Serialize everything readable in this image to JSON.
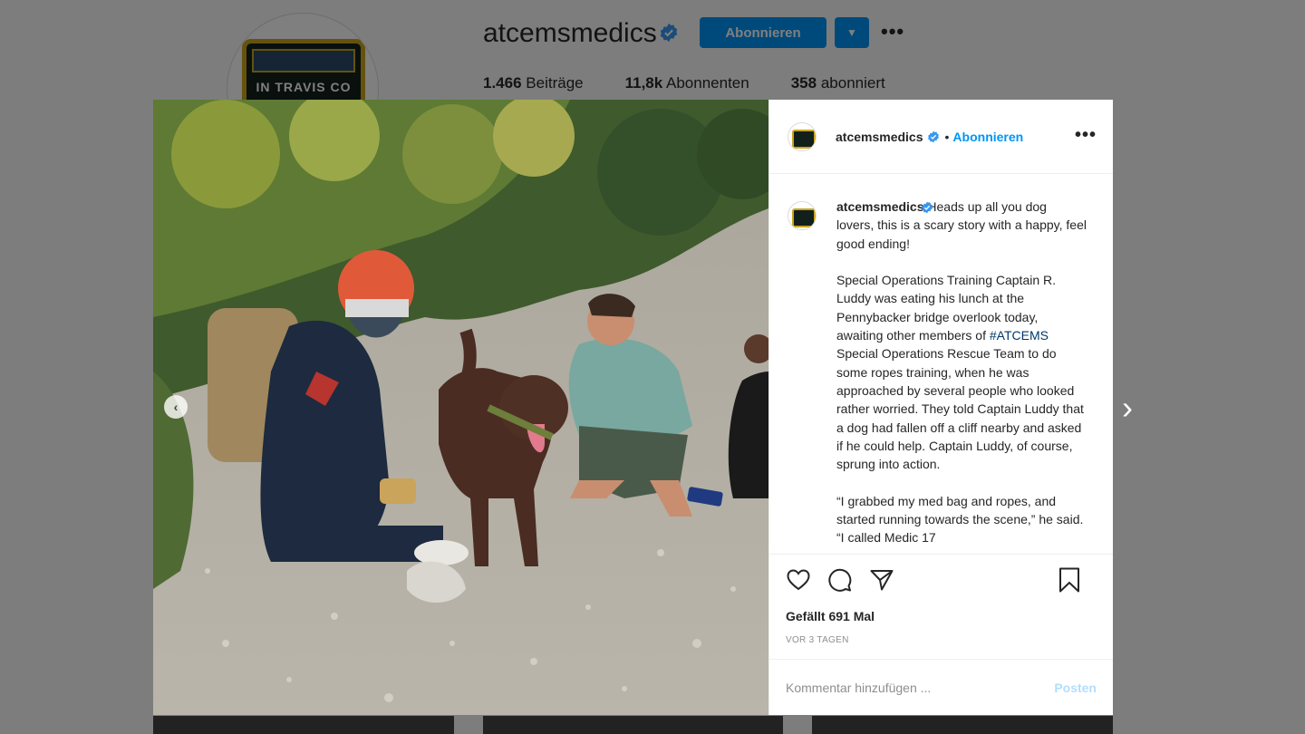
{
  "profile": {
    "username": "atcemsmedics",
    "follow_label": "Abonnieren",
    "more_glyph": "•••",
    "dropdown_icon": "chevron-down-icon",
    "avatar_text": "IN TRAVIS CO",
    "stats": [
      {
        "count": "1.466",
        "label": "Beiträge"
      },
      {
        "count": "11,8k",
        "label": "Abonnenten"
      },
      {
        "count": "358",
        "label": "abonniert"
      }
    ]
  },
  "post": {
    "header": {
      "username": "atcemsmedics",
      "separator": "•",
      "follow_label": "Abonnieren",
      "more_glyph": "•••"
    },
    "caption": {
      "username": "atcemsmedics",
      "text_1": " Heads up all you dog lovers, this is a scary story with a happy, feel good ending!\n\nSpecial Operations Training Captain R. Luddy was eating his lunch at the Pennybacker bridge overlook today, awaiting other members of ",
      "hashtag": "#ATCEMS",
      "text_2": " Special Operations Rescue Team to do some ropes training, when he was approached by several people who looked rather worried. They told Captain Luddy that a dog had fallen off a cliff nearby and asked if he could help. Captain Luddy, of course, sprung into action.\n\n“I grabbed my med bag and ropes, and started running towards the scene,” he said. “I called Medic 17"
    },
    "likes": "Gefällt 691 Mal",
    "timestamp": "VOR 3 TAGEN",
    "comment_placeholder": "Kommentar hinzufügen ...",
    "post_label": "Posten",
    "prev_glyph": "‹",
    "next_glyph": "›"
  },
  "colors": {
    "accent": "#0095f6",
    "hashtag": "#00376b",
    "muted": "#8e8e8e",
    "post_disabled": "#b2dffc"
  }
}
